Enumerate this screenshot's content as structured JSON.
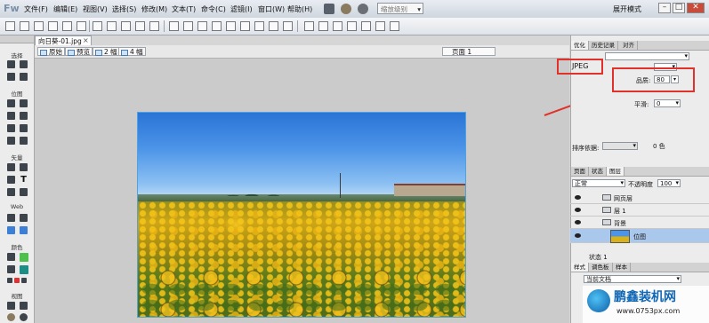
{
  "app": {
    "logo": "Fw",
    "mode": "展开模式",
    "zoom": "缩放级别"
  },
  "menu": [
    "文件(F)",
    "编辑(E)",
    "视图(V)",
    "选择(S)",
    "修改(M)",
    "文本(T)",
    "命令(C)",
    "滤镜(I)",
    "窗口(W)",
    "帮助(H)"
  ],
  "tools": {
    "sections": [
      "选择",
      "位图",
      "矢量",
      "Web",
      "颜色",
      "视图"
    ]
  },
  "document": {
    "tab": "向日葵-01.jpg",
    "views": [
      "原始",
      "预览",
      "2 幅",
      "4 幅"
    ],
    "page": "页面 1"
  },
  "optimize_panel": {
    "tabs": [
      "优化",
      "历史记录",
      "对齐"
    ],
    "format": "JPEG",
    "quality_label": "品质:",
    "quality_value": "80",
    "smooth_label": "平滑:",
    "smooth_value": "0",
    "sort_label": "排序依据:",
    "colors_count": "0 色"
  },
  "layers_panel": {
    "tabs": [
      "页面",
      "状态",
      "图层"
    ],
    "blend": "正常",
    "opacity_label": "不透明度",
    "opacity": "100",
    "layers": [
      "网页层",
      "层 1",
      "背景",
      "位图"
    ],
    "status": "状态 1"
  },
  "styles_panel": {
    "tabs": [
      "样式",
      "调色板",
      "样本"
    ],
    "doc": "当前文档"
  },
  "watermark": {
    "name": "鹏鑫装机网",
    "url": "www.0753px.com"
  },
  "colors": {
    "highlight": "#e0312a",
    "selection": "#aac7ec",
    "canvas_border": "#4fa3e0"
  }
}
